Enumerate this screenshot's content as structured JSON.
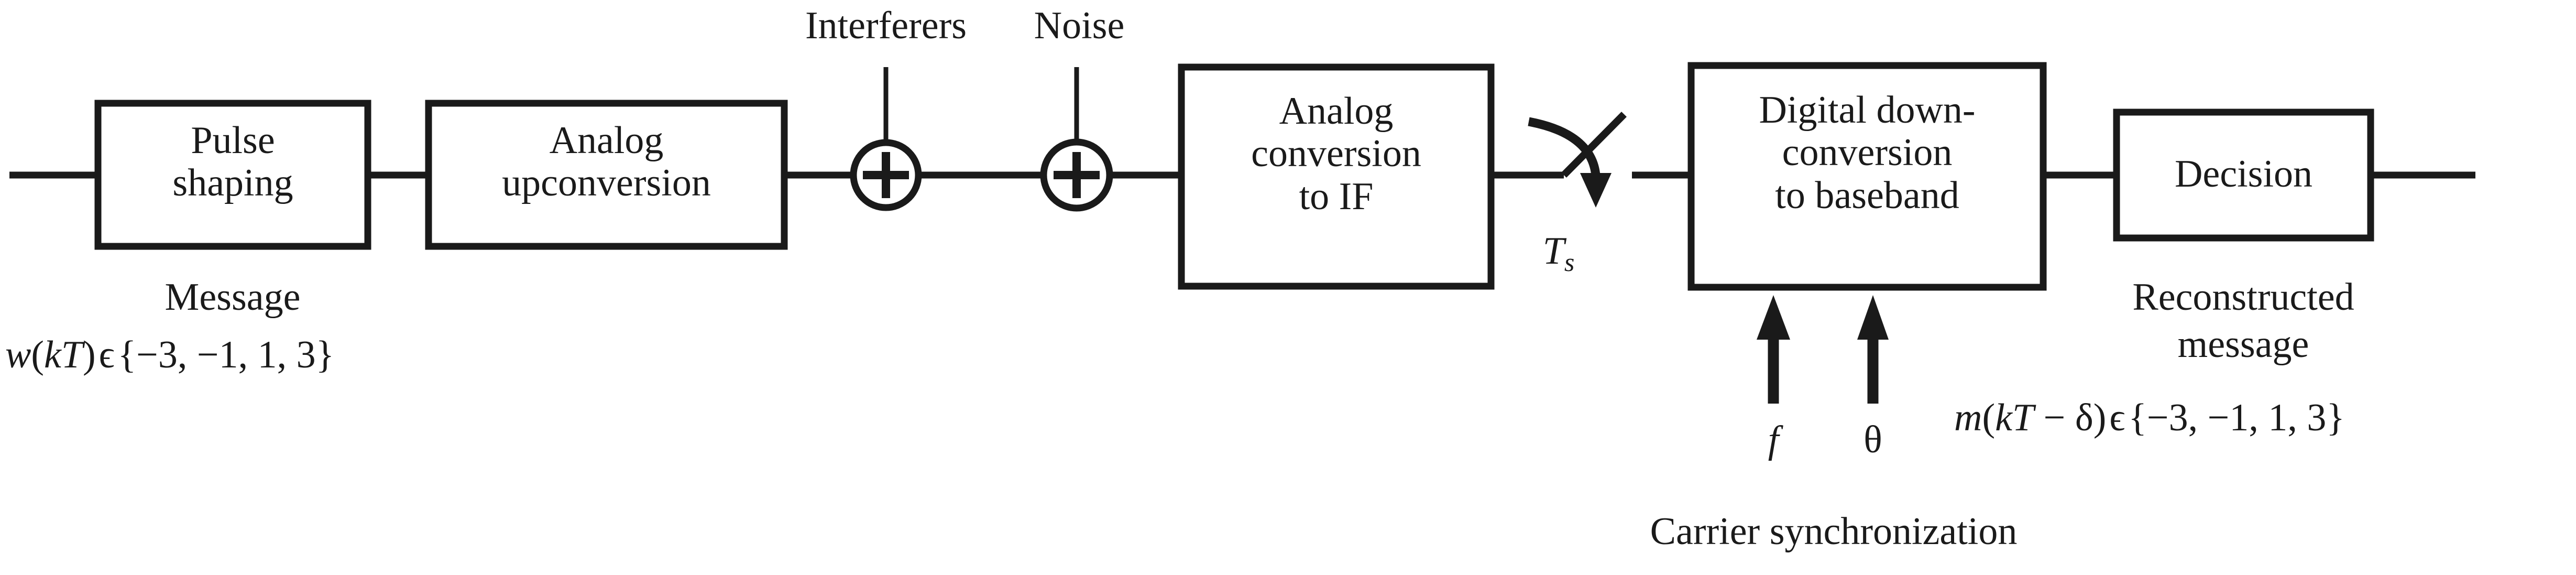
{
  "diagram": {
    "title": "Digital communication system block diagram",
    "line_color": "#1a1a1a",
    "background": "#ffffff",
    "blocks": [
      {
        "id": "pulse-shaping",
        "line1": "Pulse",
        "line2": "shaping",
        "line3": ""
      },
      {
        "id": "analog-upconv",
        "line1": "Analog",
        "line2": "upconversion",
        "line3": ""
      },
      {
        "id": "analog-to-if",
        "line1": "Analog",
        "line2": "conversion",
        "line3": "to IF"
      },
      {
        "id": "digital-downconv",
        "line1": "Digital down-",
        "line2": "conversion",
        "line3": "to baseband"
      },
      {
        "id": "decision",
        "line1": "Decision",
        "line2": "",
        "line3": ""
      }
    ],
    "adders": [
      {
        "id": "adder-interferers",
        "symbol": "+",
        "source": "Interferers"
      },
      {
        "id": "adder-noise",
        "symbol": "+",
        "source": "Noise"
      }
    ],
    "top_labels": {
      "interferers": "Interferers",
      "noise": "Noise"
    },
    "sampler": {
      "label_base": "T",
      "label_sub": "s"
    },
    "carrier_sync": {
      "freq_label": "f",
      "phase_label": "θ",
      "caption": "Carrier synchronization"
    },
    "input_annotation": {
      "title": "Message",
      "equation": "w(kT) ϵ {−3, −1, 1, 3}",
      "eq_var": "w",
      "eq_arg_open": "(",
      "eq_arg": "kT",
      "eq_arg_close": ")",
      "eq_member": "ϵ",
      "eq_set": "{−3, −1, 1, 3}"
    },
    "output_annotation": {
      "title_line1": "Reconstructed",
      "title_line2": "message",
      "equation": "m(kT − δ) ϵ {−3, −1, 1, 3}",
      "eq_var": "m",
      "eq_arg_open": "(",
      "eq_arg": "kT",
      "eq_minus": " − ",
      "eq_delta": "δ",
      "eq_arg_close": ")",
      "eq_member": "ϵ",
      "eq_set": "{−3, −1, 1, 3}"
    }
  }
}
